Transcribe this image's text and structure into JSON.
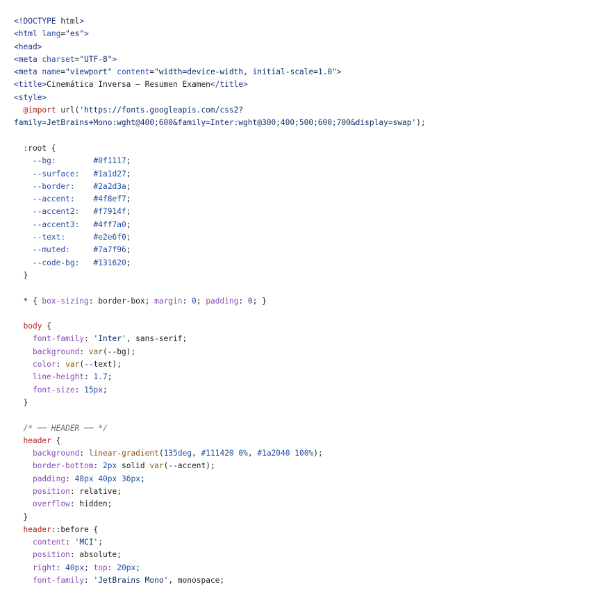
{
  "lines": [
    "<!DOCTYPE html>",
    "<html lang=\"es\">",
    "<head>",
    "<meta charset=\"UTF-8\">",
    "<meta name=\"viewport\" content=\"width=device-width, initial-scale=1.0\">",
    "<title>Cinemática Inversa — Resumen Examen</title>",
    "<style>",
    "  @import url('https://fonts.googleapis.com/css2?",
    "family=JetBrains+Mono:wght@400;600&family=Inter:wght@300;400;500;600;700&display=swap');",
    "",
    "  :root {",
    "    --bg:        #0f1117;",
    "    --surface:   #1a1d27;",
    "    --border:    #2a2d3a;",
    "    --accent:    #4f8ef7;",
    "    --accent2:   #f7914f;",
    "    --accent3:   #4ff7a0;",
    "    --text:      #e2e6f0;",
    "    --muted:     #7a7f96;",
    "    --code-bg:   #131620;",
    "  }",
    "",
    "  * { box-sizing: border-box; margin: 0; padding: 0; }",
    "",
    "  body {",
    "    font-family: 'Inter', sans-serif;",
    "    background: var(--bg);",
    "    color: var(--text);",
    "    line-height: 1.7;",
    "    font-size: 15px;",
    "  }",
    "",
    "  /* ── HEADER ── */",
    "  header {",
    "    background: linear-gradient(135deg, #111420 0%, #1a2040 100%);",
    "    border-bottom: 2px solid var(--accent);",
    "    padding: 48px 40px 36px;",
    "    position: relative;",
    "    overflow: hidden;",
    "  }",
    "  header::before {",
    "    content: 'MCI';",
    "    position: absolute;",
    "    right: 40px; top: 20px;",
    "    font-family: 'JetBrains Mono', monospace;"
  ]
}
